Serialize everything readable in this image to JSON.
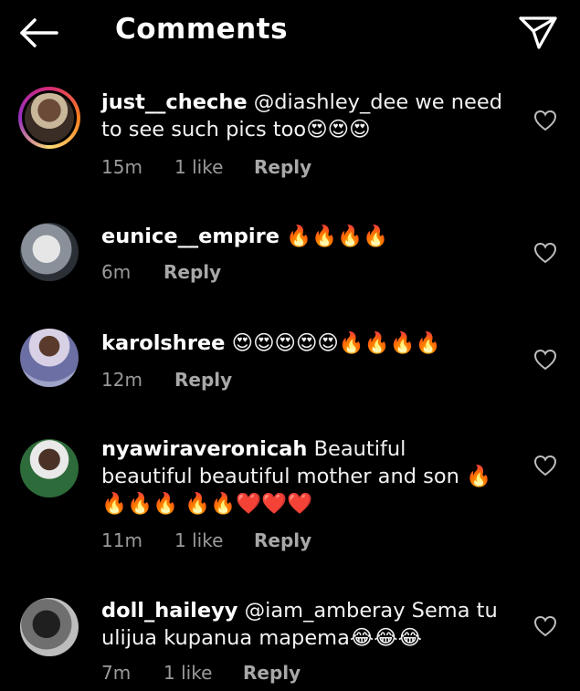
{
  "header": {
    "title": "Comments",
    "back_icon": "arrow-left-icon",
    "send_icon": "paper-plane-icon"
  },
  "comments": [
    {
      "username": "just__cheche",
      "mention": "@diashley_dee",
      "text": "we need to see such pics too😍😍😍",
      "time": "15m",
      "likes": "1 like",
      "reply": "Reply",
      "has_story_ring": true
    },
    {
      "username": "eunice__empire",
      "text": "🔥🔥🔥🔥",
      "time": "6m",
      "likes": "",
      "reply": "Reply",
      "has_story_ring": false
    },
    {
      "username": "karolshree",
      "text": "😍😍😍😍😍🔥🔥🔥🔥",
      "time": "12m",
      "likes": "",
      "reply": "Reply",
      "has_story_ring": false
    },
    {
      "username": "nyawiraveronicah",
      "text": "Beautiful beautiful beautiful mother and son 🔥🔥🔥🔥 🔥🔥❤️❤️❤️",
      "time": "11m",
      "likes": "1 like",
      "reply": "Reply",
      "has_story_ring": false
    },
    {
      "username": "doll_haileyy",
      "mention": "@iam_amberay",
      "text": " Sema tu ulijua kupanua mapema😂😂😂",
      "time": "7m",
      "likes": "1 like",
      "reply": "Reply",
      "has_story_ring": false
    }
  ],
  "colors": {
    "background": "#000000",
    "text": "#ffffff",
    "meta": "#9a9a9a"
  }
}
